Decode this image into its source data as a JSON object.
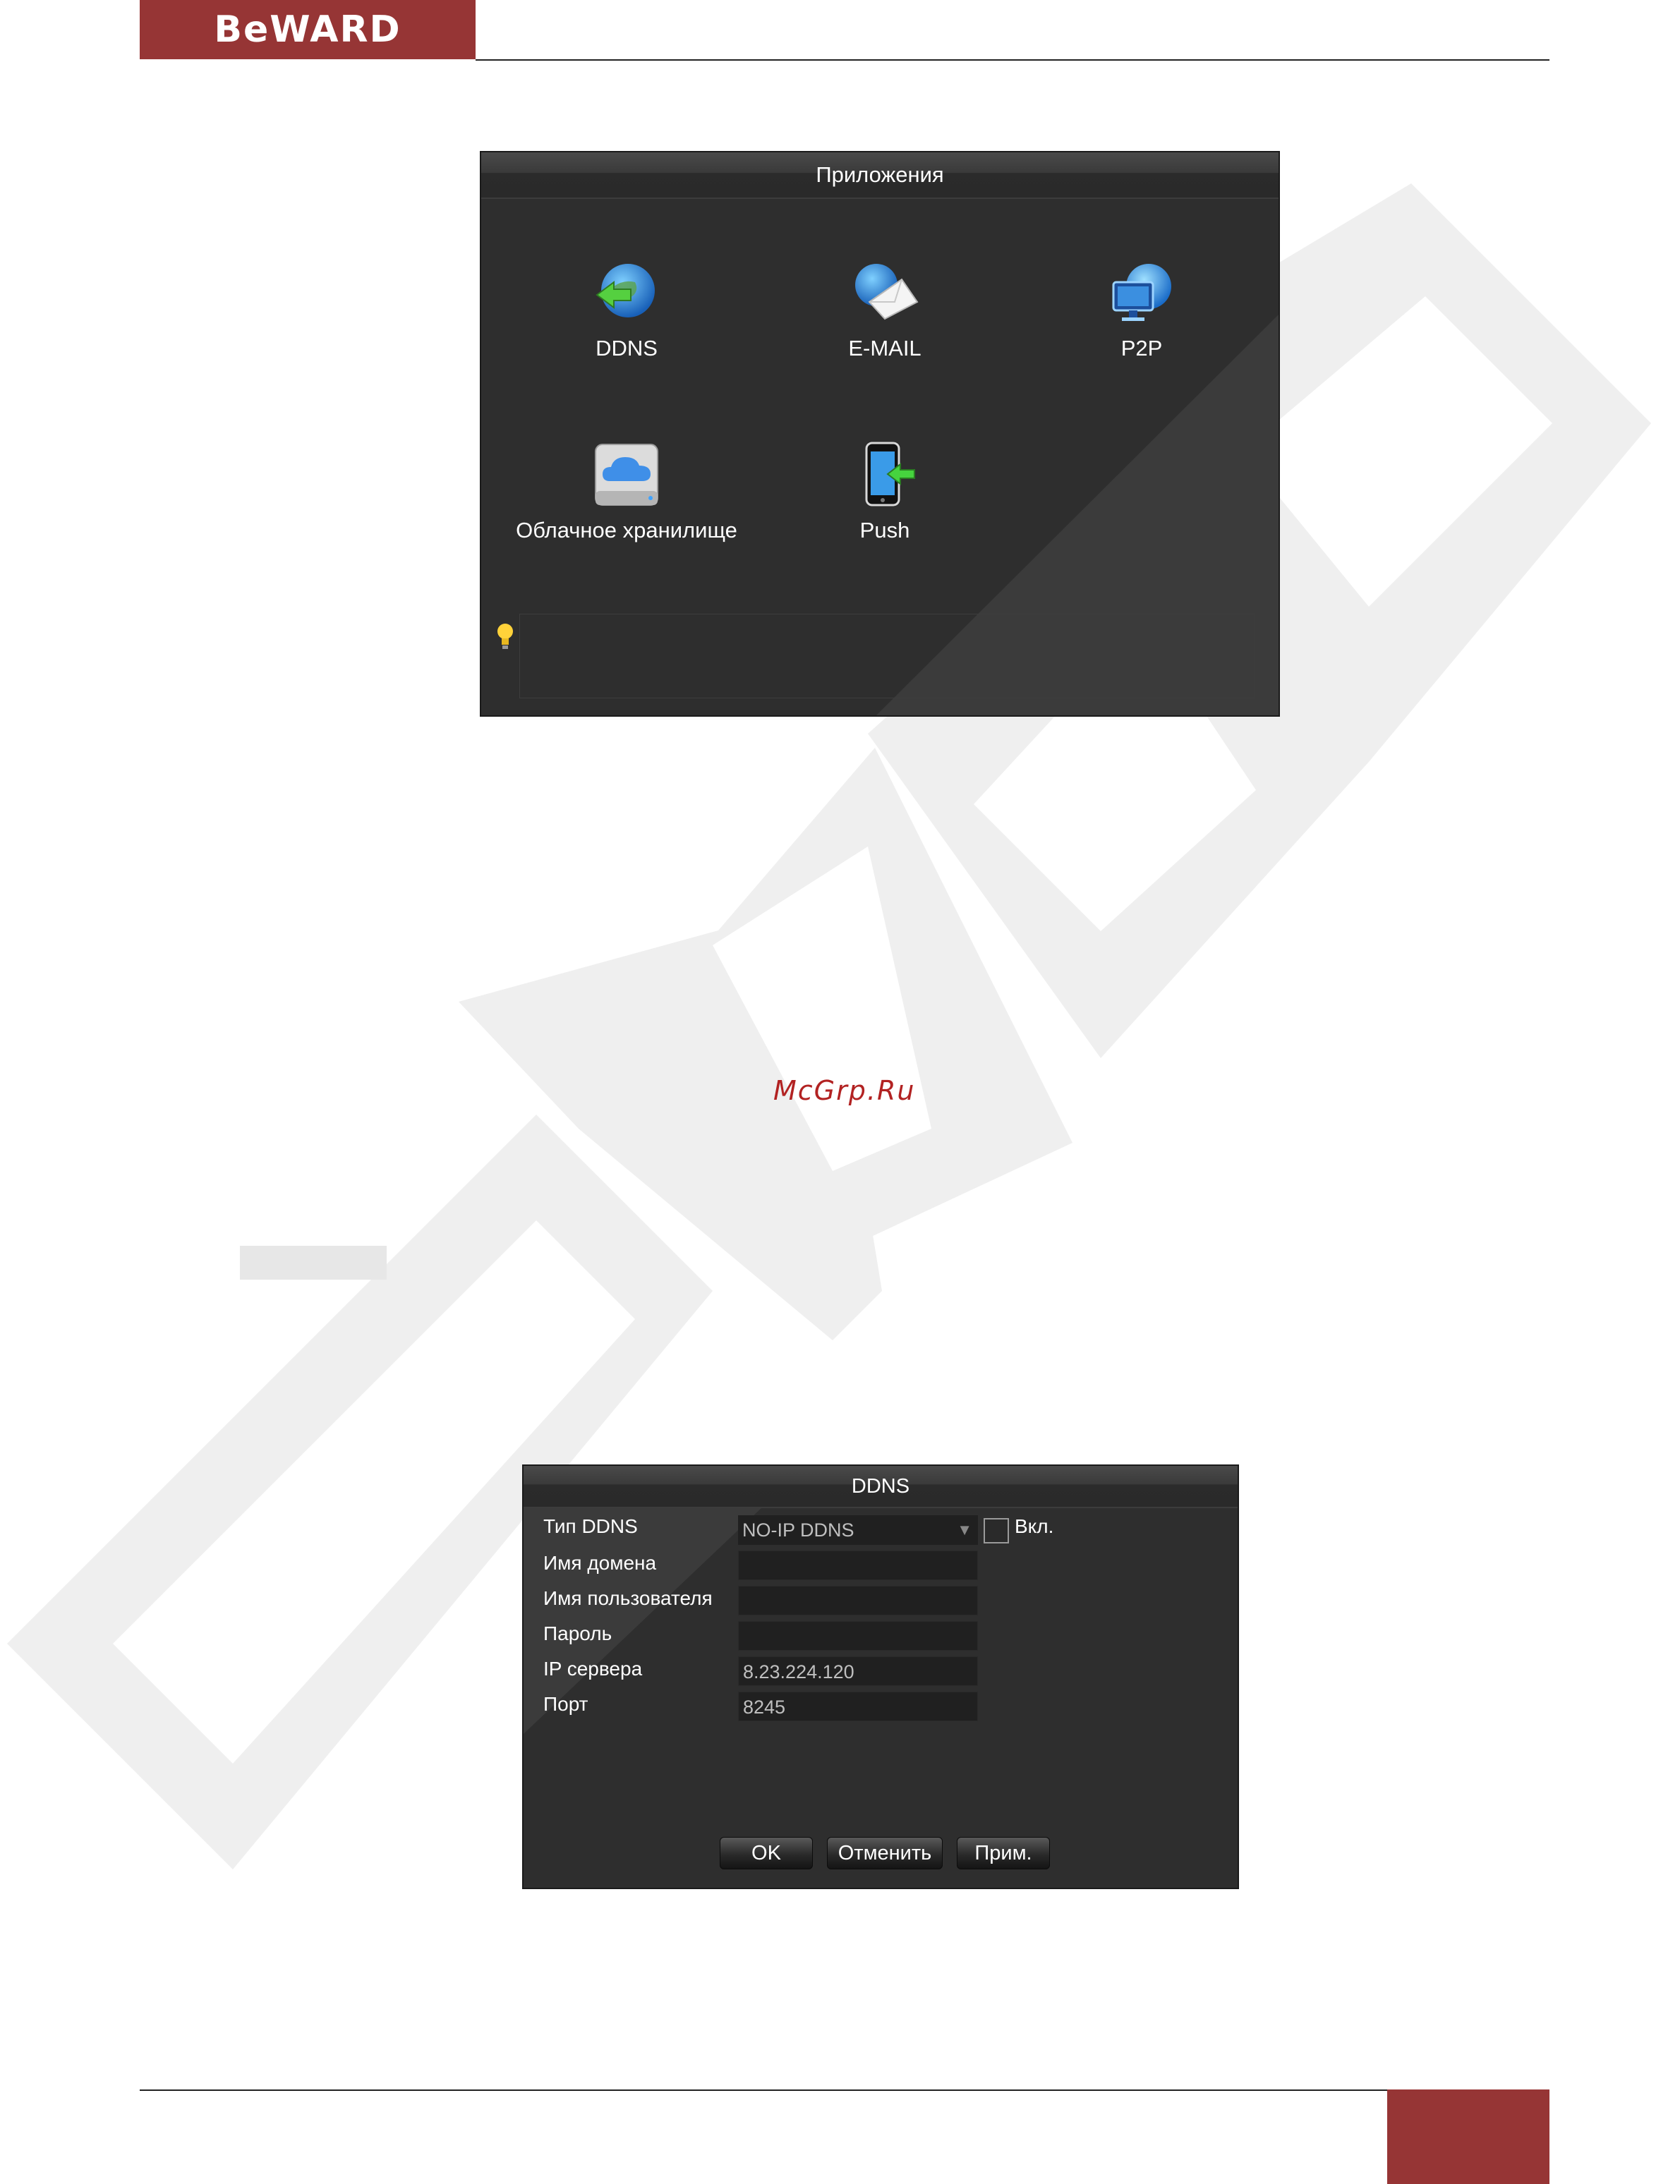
{
  "header": {
    "logo_text": "BeWARD"
  },
  "watermark_site": "McGrp.Ru",
  "apps_window": {
    "title": "Приложения",
    "items": [
      {
        "label": "DDNS",
        "icon": "ddns-globe-arrow-icon"
      },
      {
        "label": "E-MAIL",
        "icon": "email-globe-envelope-icon"
      },
      {
        "label": "P2P",
        "icon": "p2p-monitor-globe-icon"
      },
      {
        "label": "Облачное хранилище",
        "icon": "cloud-storage-icon"
      },
      {
        "label": "Push",
        "icon": "push-phone-icon"
      }
    ],
    "tip_icon": "lightbulb-icon",
    "tip_text": ""
  },
  "ddns_window": {
    "title": "DDNS",
    "fields": {
      "type_label": "Тип DDNS",
      "type_value": "NO-IP DDNS",
      "enable_label": "Вкл.",
      "enabled": false,
      "domain_label": "Имя домена",
      "domain_value": "",
      "user_label": "Имя пользователя",
      "user_value": "",
      "password_label": "Пароль",
      "password_value": "",
      "server_label": "IP сервера",
      "server_value": "8.23.224.120",
      "port_label": "Порт",
      "port_value": "8245"
    },
    "buttons": {
      "ok": "OK",
      "cancel": "Отменить",
      "apply": "Прим."
    }
  },
  "colors": {
    "brand": "#963535",
    "window_bg": "#2e2e2e",
    "watermark": "#efefef"
  }
}
